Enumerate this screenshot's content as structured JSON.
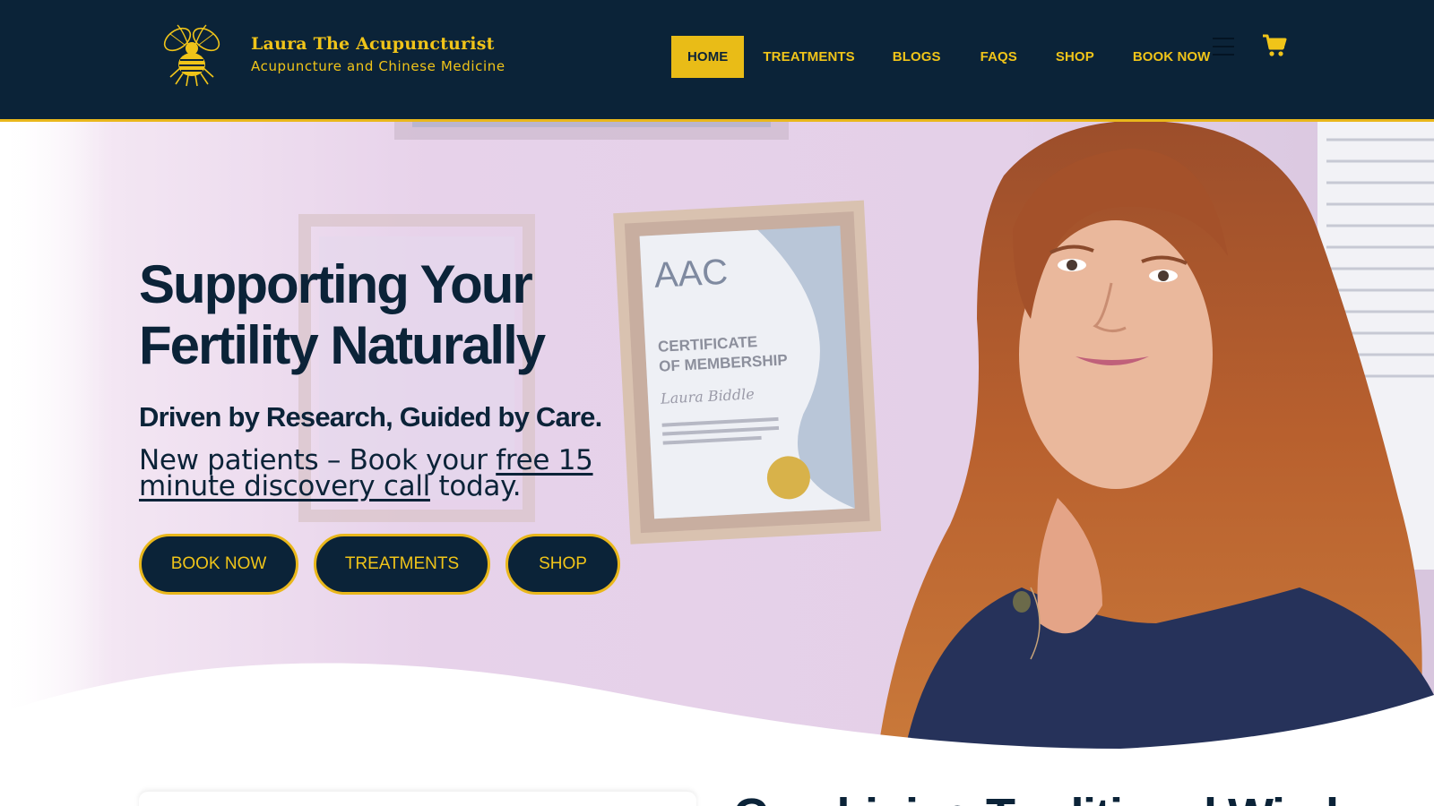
{
  "brand": {
    "title": "Laura The Acupuncturist",
    "subtitle": "Acupuncture and Chinese Medicine",
    "logo_icon": "bee-logo-icon"
  },
  "nav": {
    "items": [
      {
        "label": "HOME",
        "active": true
      },
      {
        "label": "TREATMENTS",
        "active": false
      },
      {
        "label": "BLOGS",
        "active": false
      },
      {
        "label": "FAQS",
        "active": false
      },
      {
        "label": "SHOP",
        "active": false
      },
      {
        "label": "BOOK NOW",
        "active": false
      }
    ],
    "menu_icon": "hamburger-menu-icon",
    "cart_icon": "shopping-cart-icon"
  },
  "hero": {
    "title": "Supporting Your Fertility Naturally",
    "subtitle": "Driven by Research, Guided by Care.",
    "text_before": "New patients – Book your ",
    "text_link": "free 15 minute discovery call",
    "text_after": " today.",
    "buttons": [
      "BOOK NOW",
      "TREATMENTS",
      "SHOP"
    ],
    "certificate_text": [
      "AAC",
      "CERTIFICATE",
      "OF MEMBERSHIP",
      "Laura Biddle"
    ]
  },
  "next_section": {
    "heading": "Combining Traditional Wisdom"
  },
  "colors": {
    "navy": "#0b2338",
    "gold": "#f0c419",
    "gold_active": "#e9bc17",
    "hero_tint": "#e8d3ec"
  }
}
